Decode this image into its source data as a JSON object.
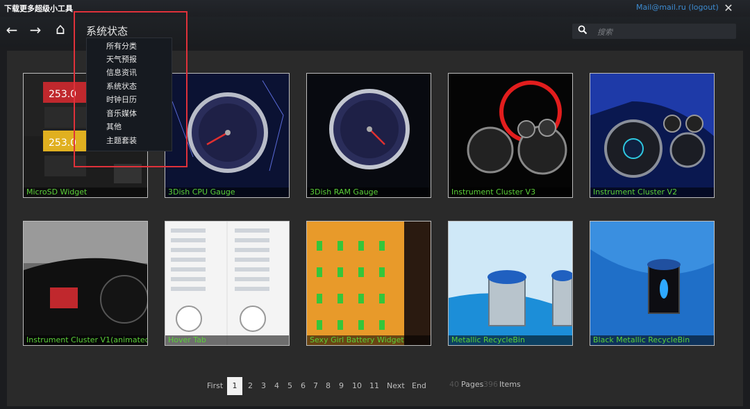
{
  "window": {
    "title": "下载更多超级小工具",
    "account": "Mail@mail.ru (logout)",
    "close_glyph": "✕"
  },
  "nav": {
    "back_glyph": "←",
    "forward_glyph": "→",
    "home_glyph": "⌂",
    "title": "系统状态"
  },
  "search": {
    "placeholder": "搜索",
    "value": "",
    "icon_glyph": "🔍"
  },
  "category_menu": {
    "items": [
      "所有分类",
      "天气预报",
      "信息资讯",
      "系统状态",
      "时钟日历",
      "音乐媒体",
      "其他",
      "主题套装"
    ]
  },
  "widgets": [
    {
      "name": "MicroSD Widget",
      "icon": "microsd-widget-thumbnail"
    },
    {
      "name": "3Dish CPU Gauge",
      "icon": "cpu-gauge-thumbnail"
    },
    {
      "name": "3Dish RAM Gauge",
      "icon": "ram-gauge-thumbnail"
    },
    {
      "name": "Instrument Cluster V3",
      "icon": "instrument-cluster-v3-thumbnail"
    },
    {
      "name": "Instrument Cluster V2",
      "icon": "instrument-cluster-v2-thumbnail"
    },
    {
      "name": "Instrument Cluster V1(animated",
      "icon": "instrument-cluster-v1-thumbnail"
    },
    {
      "name": "Hover Tab",
      "icon": "hover-tab-thumbnail"
    },
    {
      "name": "Sexy Girl Battery Widget",
      "icon": "battery-widget-thumbnail"
    },
    {
      "name": "Metallic RecycleBin",
      "icon": "metallic-recyclebin-thumbnail"
    },
    {
      "name": "Black Metallic RecycleBin",
      "icon": "black-metallic-recyclebin-thumbnail"
    }
  ],
  "pagination": {
    "first": "First",
    "pages": [
      "1",
      "2",
      "3",
      "4",
      "5",
      "6",
      "7",
      "8",
      "9",
      "10",
      "11"
    ],
    "current": "1",
    "next": "Next",
    "end": "End",
    "total_pages": "40",
    "pages_label": "Pages",
    "total_items": "396",
    "items_label": "Items"
  },
  "colors": {
    "label_green": "#5bd038",
    "accent_blue": "#3d8bd0",
    "highlight_red": "#e0313a"
  }
}
